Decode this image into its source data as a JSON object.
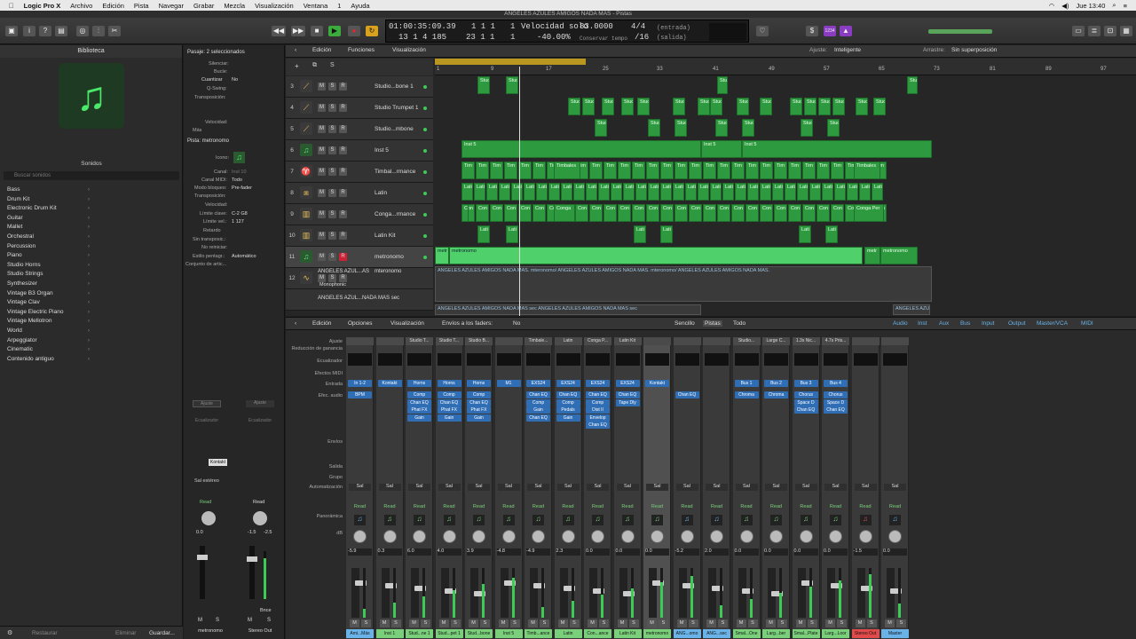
{
  "menubar": {
    "app": "Logic Pro X",
    "items": [
      "Archivo",
      "Edición",
      "Pista",
      "Navegar",
      "Grabar",
      "Mezcla",
      "Visualización",
      "Ventana",
      "1",
      "Ayuda"
    ],
    "clock": "Jue 13:40"
  },
  "window_title": "ANGELES AZULES AMIGOS NADA MAS - Pistas",
  "lcd": {
    "time": "01:00:35:09.39",
    "bars": "13  1  4  185",
    "pos1": "1  1  1",
    "pos2": "23  1  1",
    "beat1": "1",
    "beat2": "1",
    "tempo_label": "Velocidad solo",
    "tempo": "83.0000",
    "tempo_pct": "-40.00%",
    "conservar": "Conservar tempo",
    "sig": "4/4",
    "div": "/16",
    "in": "(entrada)",
    "out": "(salida)"
  },
  "library": {
    "title": "Biblioteca",
    "sounds": "Sonidos",
    "search_placeholder": "Buscar sonidos",
    "items": [
      "Bass",
      "Drum Kit",
      "Electronic Drum Kit",
      "Guitar",
      "Mallet",
      "Orchestral",
      "Percussion",
      "Piano",
      "Studio Horns",
      "Studio Strings",
      "Synthesizer",
      "Vintage B3 Organ",
      "Vintage Clav",
      "Vintage Electric Piano",
      "Vintage Mellotron",
      "World",
      "Arpeggiator",
      "Cinematic",
      "Contenido antiguo"
    ],
    "restore": "Restaurar",
    "delete": "Eliminar",
    "save": "Guardar..."
  },
  "inspector": {
    "region_title": "Pasaje: 2 seleccionados",
    "rows": [
      "Silenciar:",
      "Bucle:",
      "Cuantizar",
      "Q-Swing:",
      "Transposición:",
      "Velocidad:",
      "Más"
    ],
    "cuantizar_val": "No",
    "track_title": "Pista: metronomo",
    "icon_label": "Icono:",
    "channel_label": "Canal:",
    "channel_val": "Inst 10",
    "midi_label": "Canal MIDI:",
    "midi_val": "Todo",
    "bloq_label": "Modo bloqueo:",
    "bloq_val": "Pre-fader",
    "trans_label": "Transposición:",
    "vel_label": "Velocidad:",
    "lim_clave": "Límite clave:",
    "lim_clave_val": "C-2  G8",
    "lim_vel": "Límite vel.:",
    "lim_vel_val": "1  127",
    "retardo": "Retardo",
    "sin_trans": "Sin transposic.:",
    "no_reiniciar": "No reiniciar:",
    "estilo": "Estilo pentagr.:",
    "estilo_val": "Automático",
    "conjunto": "Conjunto de artic...",
    "strip1_name": "metronomo",
    "strip2_name": "Stereo Out",
    "sal_estereo": "Sal estéreo",
    "tooltip": "Kontakt",
    "ajuste": "Ajuste",
    "ecualizador": "Ecualizador",
    "read": "Read",
    "bnce": "Bnce",
    "vol1": "0.0",
    "vol2": "-1.5",
    "vol2b": "-2.5"
  },
  "tracks_bar": {
    "edicion": "Edición",
    "funciones": "Funciones",
    "visualizacion": "Visualización",
    "ajuste_label": "Ajuste:",
    "ajuste_val": "Inteligente",
    "arrastre_label": "Arrastre:",
    "arrastre_val": "Sin superposición"
  },
  "ruler": [
    "1",
    "9",
    "17",
    "25",
    "33",
    "41",
    "49",
    "57",
    "65",
    "73",
    "81",
    "89",
    "97"
  ],
  "tracks": [
    {
      "num": "3",
      "name": "Studio...bone 1",
      "icon": "trombone-icon"
    },
    {
      "num": "4",
      "name": "Studio Trumpet 1",
      "icon": "trumpet-icon"
    },
    {
      "num": "5",
      "name": "Studio...mbone",
      "icon": "trombone-icon"
    },
    {
      "num": "6",
      "name": "Inst 5",
      "icon": "note-icon"
    },
    {
      "num": "7",
      "name": "Timbal...rmance",
      "icon": "timbales-icon"
    },
    {
      "num": "8",
      "name": "Latin",
      "icon": "shaker-icon"
    },
    {
      "num": "9",
      "name": "Conga...rmance",
      "icon": "conga-icon"
    },
    {
      "num": "10",
      "name": "Latin Kit",
      "icon": "drum-icon"
    },
    {
      "num": "11",
      "name": "metronomo",
      "icon": "note-icon"
    },
    {
      "num": "12",
      "name": "ANGELES AZUL...AS",
      "icon": "waveform-icon",
      "extra": "mteronomo",
      "mono": "Monophonic"
    },
    {
      "num": "",
      "name": "ANGELES AZUL...NADA MAS sec",
      "icon": ""
    }
  ],
  "region_labels": {
    "stud": "Stud",
    "inst5": "Inst 5",
    "tim": "Tim",
    "timbales": "Timbales",
    "lati": "Lati",
    "con": "Con",
    "conga": "Conga",
    "congaper": "Conga Per",
    "c": "C",
    "metr": "metr",
    "metronomo": "metronomo",
    "audio1": "ANGELES AZULES AMIGOS NADA MAS. mteronomo/ ANGELES AZULES AMIGOS NADA MAS. mteronomo/ ANGELES AZULES AMIGOS NADA MAS.",
    "audio2": "ANGELES AZULES AMIGOS NADA MAS sec  ANGELES AZULES AMIGOS NADA MAS sec",
    "audio3": "ANGELES AZULE"
  },
  "mixer_bar": {
    "edicion": "Edición",
    "opciones": "Opciones",
    "visualizacion": "Visualización",
    "envios": "Envíos a los faders:",
    "envios_val": "No",
    "sencillo": "Sencillo",
    "pistas": "Pistas",
    "todo": "Todo",
    "filters": [
      "Audio",
      "Inst",
      "Aux",
      "Bus",
      "Input",
      "Output",
      "Master/VCA",
      "MIDI"
    ]
  },
  "mixer_rows": [
    "Ajuste",
    "Reducción de ganancia",
    "Ecualizador",
    "Efectos MIDI",
    "Entrada",
    "Efec. audio",
    "Envíos",
    "Salida",
    "Grupo",
    "Automatización",
    "",
    "Panorámica",
    "dB"
  ],
  "strips": [
    {
      "top": "",
      "input": "In 1-2",
      "plugins": [
        "BPM"
      ],
      "bot": "Ami...Más",
      "vol": "-5.9",
      "color": "#6ab3e8"
    },
    {
      "top": "",
      "input": "Kontakt",
      "plugins": [],
      "bot": "Inst 1",
      "vol": "0.3",
      "color": "#7ad07a"
    },
    {
      "top": "Studio T...",
      "input": "Horns",
      "plugins": [
        "Comp",
        "Chan EQ",
        "Phat FX",
        "Gain"
      ],
      "bot": "Stud...ne 1",
      "vol": "6.0",
      "color": "#7ad07a"
    },
    {
      "top": "Studio T...",
      "input": "Horns",
      "plugins": [
        "Comp",
        "Chan EQ",
        "Phat FX",
        "Gain"
      ],
      "bot": "Stud...pet 1",
      "vol": "4.0",
      "color": "#7ad07a"
    },
    {
      "top": "Studio B...",
      "input": "Horns",
      "plugins": [
        "Comp",
        "Chan EQ",
        "Phat FX",
        "Gain"
      ],
      "bot": "Stud...bone",
      "vol": "3.9",
      "color": "#7ad07a"
    },
    {
      "top": "",
      "input": "M1",
      "plugins": [],
      "bot": "Inst 5",
      "vol": "-4.8",
      "color": "#7ad07a"
    },
    {
      "top": "Timbale...",
      "input": "EXS24",
      "plugins": [
        "Chan EQ",
        "Comp",
        "Gain",
        "Chan EQ"
      ],
      "bot": "Timb...ance",
      "vol": "-4.9",
      "color": "#7ad07a"
    },
    {
      "top": "Latin",
      "input": "EXS24",
      "plugins": [
        "Chan EQ",
        "Comp",
        "Pedals",
        "Gain"
      ],
      "bot": "Latin",
      "vol": "2.3",
      "color": "#7ad07a"
    },
    {
      "top": "Conga P...",
      "input": "EXS24",
      "plugins": [
        "Chan EQ",
        "Comp",
        "Dist II",
        "Envelop",
        "Chan EQ"
      ],
      "bot": "Con...ance",
      "vol": "0.0",
      "color": "#7ad07a"
    },
    {
      "top": "Latin Kit",
      "input": "EXS24",
      "plugins": [
        "Chan EQ",
        "Tape Dly"
      ],
      "bot": "Latin Kit",
      "vol": "0.0",
      "color": "#7ad07a"
    },
    {
      "top": "",
      "input": "Kontakt",
      "plugins": [],
      "bot": "metronomo",
      "vol": "0.0",
      "color": "#7ad07a"
    },
    {
      "top": "",
      "input": "",
      "plugins": [
        "Chan EQ"
      ],
      "bot": "ANG...omo",
      "vol": "-5.2",
      "color": "#6ab3e8"
    },
    {
      "top": "",
      "input": "",
      "plugins": [],
      "bot": "ANG...sec",
      "vol": "2.0",
      "color": "#6ab3e8"
    },
    {
      "top": "Studio...",
      "input": "Bus 1",
      "plugins": [
        "Chroma"
      ],
      "bot": "Smal...One",
      "vol": "0.0",
      "color": "#7ad07a"
    },
    {
      "top": "Large C...",
      "input": "Bus 2",
      "plugins": [
        "Chroma"
      ],
      "bot": "Larg...ber",
      "vol": "0.0",
      "color": "#7ad07a"
    },
    {
      "top": "1.3s Nic...",
      "input": "Bus 3",
      "plugins": [
        "Chorus",
        "Space D",
        "Chan EQ"
      ],
      "bot": "Smal...Plate",
      "vol": "0.0",
      "color": "#7ad07a"
    },
    {
      "top": "4.7s Pris...",
      "input": "Bus 4",
      "plugins": [
        "Chorus",
        "Space D",
        "Chan EQ"
      ],
      "bot": "Larg...Loor",
      "vol": "0.0",
      "color": "#7ad07a"
    },
    {
      "top": "",
      "input": "",
      "plugins": [],
      "bot": "Stereo Out",
      "vol": "-1.5",
      "color": "#e04a4a"
    },
    {
      "top": "",
      "input": "",
      "plugins": [],
      "bot": "Master",
      "vol": "0.0",
      "color": "#6ab3e8"
    }
  ],
  "strip_labels": {
    "read": "Read",
    "sal": "Sal",
    "m": "M",
    "s": "S"
  }
}
